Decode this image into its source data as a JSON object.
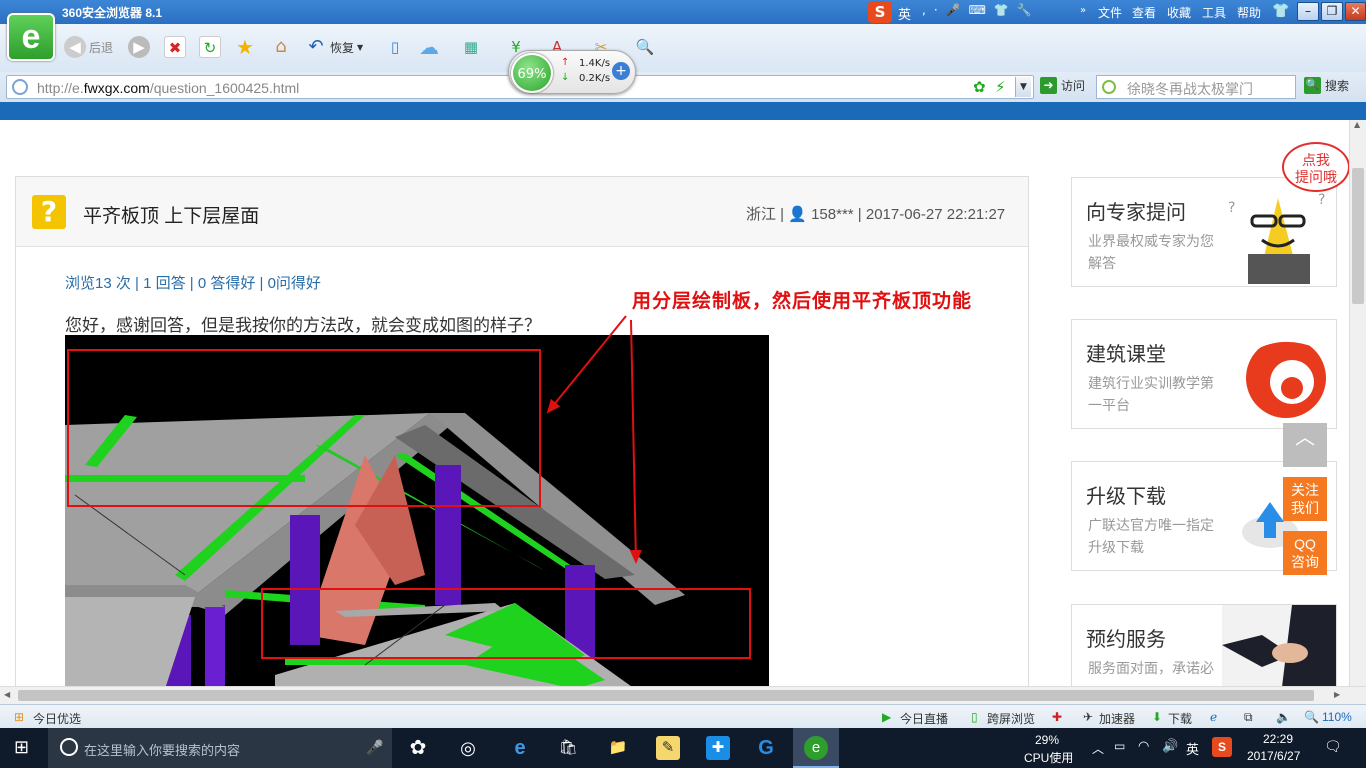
{
  "browser": {
    "title": "360安全浏览器 8.1",
    "menus": [
      "文件",
      "查看",
      "收藏",
      "工具",
      "帮助"
    ],
    "toolbar": {
      "back_label": "后退",
      "restore_label": "恢复"
    },
    "address": {
      "url_prefix": "http://e.",
      "url_domain": "fwxgx.com",
      "url_path": "/question_1600425.html"
    },
    "visit_label": "访问",
    "search_placeholder": "徐晓冬再战太极掌门",
    "search_label": "搜索",
    "speed": {
      "percent": "69%",
      "upload": "1.4K/s",
      "download": "0.2K/s"
    },
    "ime": {
      "lang": "英"
    }
  },
  "question": {
    "title": "平齐板顶 上下层屋面",
    "meta": "浙江 | 👤 158*** | 2017-06-27 22:21:27",
    "stats": "浏览13 次 | 1 回答 | 0 答得好 | 0问得好",
    "body": "您好，感谢回答，但是我按你的方法改，就会变成如图的样子？",
    "annotation": "用分层绘制板，然后使用平齐板顶功能"
  },
  "sidebar": {
    "bubble": "点我\n提问哦",
    "promos": [
      {
        "title": "向专家提问",
        "sub": "业界最权威专家为您解答"
      },
      {
        "title": "建筑课堂",
        "sub": "建筑行业实训教学第一平台"
      },
      {
        "title": "升级下载",
        "sub": "广联达官方唯一指定升级下载"
      },
      {
        "title": "预约服务",
        "sub": "服务面对面，承诺必达"
      }
    ],
    "follow_label": "关注我们",
    "qq_label": "QQ咨询"
  },
  "statusbar": {
    "today": "今日优选",
    "live": "今日直播",
    "cross": "跨屏浏览",
    "accel": "加速器",
    "download": "下载",
    "zoom": "110%"
  },
  "taskbar": {
    "search_placeholder": "在这里输入你要搜索的内容",
    "cpu_percent": "29%",
    "cpu_label": "CPU使用",
    "ime": "英",
    "time": "22:29",
    "date": "2017/6/27"
  },
  "colors": {
    "brand_blue": "#1a6ab8",
    "annotation_red": "#e01010",
    "accent_orange": "#f47920"
  }
}
